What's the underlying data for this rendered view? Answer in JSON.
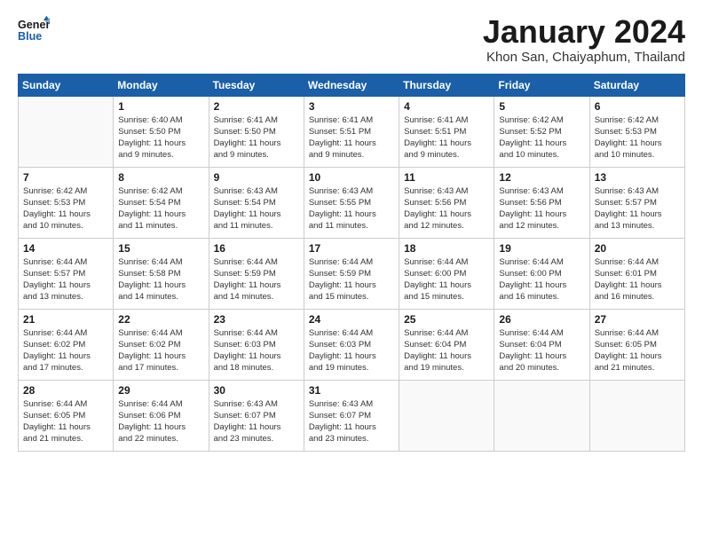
{
  "logo": {
    "line1": "General",
    "line2": "Blue"
  },
  "title": "January 2024",
  "subtitle": "Khon San, Chaiyaphum, Thailand",
  "days_header": [
    "Sunday",
    "Monday",
    "Tuesday",
    "Wednesday",
    "Thursday",
    "Friday",
    "Saturday"
  ],
  "weeks": [
    [
      {
        "day": "",
        "info": ""
      },
      {
        "day": "1",
        "info": "Sunrise: 6:40 AM\nSunset: 5:50 PM\nDaylight: 11 hours\nand 9 minutes."
      },
      {
        "day": "2",
        "info": "Sunrise: 6:41 AM\nSunset: 5:50 PM\nDaylight: 11 hours\nand 9 minutes."
      },
      {
        "day": "3",
        "info": "Sunrise: 6:41 AM\nSunset: 5:51 PM\nDaylight: 11 hours\nand 9 minutes."
      },
      {
        "day": "4",
        "info": "Sunrise: 6:41 AM\nSunset: 5:51 PM\nDaylight: 11 hours\nand 9 minutes."
      },
      {
        "day": "5",
        "info": "Sunrise: 6:42 AM\nSunset: 5:52 PM\nDaylight: 11 hours\nand 10 minutes."
      },
      {
        "day": "6",
        "info": "Sunrise: 6:42 AM\nSunset: 5:53 PM\nDaylight: 11 hours\nand 10 minutes."
      }
    ],
    [
      {
        "day": "7",
        "info": "Sunrise: 6:42 AM\nSunset: 5:53 PM\nDaylight: 11 hours\nand 10 minutes."
      },
      {
        "day": "8",
        "info": "Sunrise: 6:42 AM\nSunset: 5:54 PM\nDaylight: 11 hours\nand 11 minutes."
      },
      {
        "day": "9",
        "info": "Sunrise: 6:43 AM\nSunset: 5:54 PM\nDaylight: 11 hours\nand 11 minutes."
      },
      {
        "day": "10",
        "info": "Sunrise: 6:43 AM\nSunset: 5:55 PM\nDaylight: 11 hours\nand 11 minutes."
      },
      {
        "day": "11",
        "info": "Sunrise: 6:43 AM\nSunset: 5:56 PM\nDaylight: 11 hours\nand 12 minutes."
      },
      {
        "day": "12",
        "info": "Sunrise: 6:43 AM\nSunset: 5:56 PM\nDaylight: 11 hours\nand 12 minutes."
      },
      {
        "day": "13",
        "info": "Sunrise: 6:43 AM\nSunset: 5:57 PM\nDaylight: 11 hours\nand 13 minutes."
      }
    ],
    [
      {
        "day": "14",
        "info": "Sunrise: 6:44 AM\nSunset: 5:57 PM\nDaylight: 11 hours\nand 13 minutes."
      },
      {
        "day": "15",
        "info": "Sunrise: 6:44 AM\nSunset: 5:58 PM\nDaylight: 11 hours\nand 14 minutes."
      },
      {
        "day": "16",
        "info": "Sunrise: 6:44 AM\nSunset: 5:59 PM\nDaylight: 11 hours\nand 14 minutes."
      },
      {
        "day": "17",
        "info": "Sunrise: 6:44 AM\nSunset: 5:59 PM\nDaylight: 11 hours\nand 15 minutes."
      },
      {
        "day": "18",
        "info": "Sunrise: 6:44 AM\nSunset: 6:00 PM\nDaylight: 11 hours\nand 15 minutes."
      },
      {
        "day": "19",
        "info": "Sunrise: 6:44 AM\nSunset: 6:00 PM\nDaylight: 11 hours\nand 16 minutes."
      },
      {
        "day": "20",
        "info": "Sunrise: 6:44 AM\nSunset: 6:01 PM\nDaylight: 11 hours\nand 16 minutes."
      }
    ],
    [
      {
        "day": "21",
        "info": "Sunrise: 6:44 AM\nSunset: 6:02 PM\nDaylight: 11 hours\nand 17 minutes."
      },
      {
        "day": "22",
        "info": "Sunrise: 6:44 AM\nSunset: 6:02 PM\nDaylight: 11 hours\nand 17 minutes."
      },
      {
        "day": "23",
        "info": "Sunrise: 6:44 AM\nSunset: 6:03 PM\nDaylight: 11 hours\nand 18 minutes."
      },
      {
        "day": "24",
        "info": "Sunrise: 6:44 AM\nSunset: 6:03 PM\nDaylight: 11 hours\nand 19 minutes."
      },
      {
        "day": "25",
        "info": "Sunrise: 6:44 AM\nSunset: 6:04 PM\nDaylight: 11 hours\nand 19 minutes."
      },
      {
        "day": "26",
        "info": "Sunrise: 6:44 AM\nSunset: 6:04 PM\nDaylight: 11 hours\nand 20 minutes."
      },
      {
        "day": "27",
        "info": "Sunrise: 6:44 AM\nSunset: 6:05 PM\nDaylight: 11 hours\nand 21 minutes."
      }
    ],
    [
      {
        "day": "28",
        "info": "Sunrise: 6:44 AM\nSunset: 6:05 PM\nDaylight: 11 hours\nand 21 minutes."
      },
      {
        "day": "29",
        "info": "Sunrise: 6:44 AM\nSunset: 6:06 PM\nDaylight: 11 hours\nand 22 minutes."
      },
      {
        "day": "30",
        "info": "Sunrise: 6:43 AM\nSunset: 6:07 PM\nDaylight: 11 hours\nand 23 minutes."
      },
      {
        "day": "31",
        "info": "Sunrise: 6:43 AM\nSunset: 6:07 PM\nDaylight: 11 hours\nand 23 minutes."
      },
      {
        "day": "",
        "info": ""
      },
      {
        "day": "",
        "info": ""
      },
      {
        "day": "",
        "info": ""
      }
    ]
  ]
}
